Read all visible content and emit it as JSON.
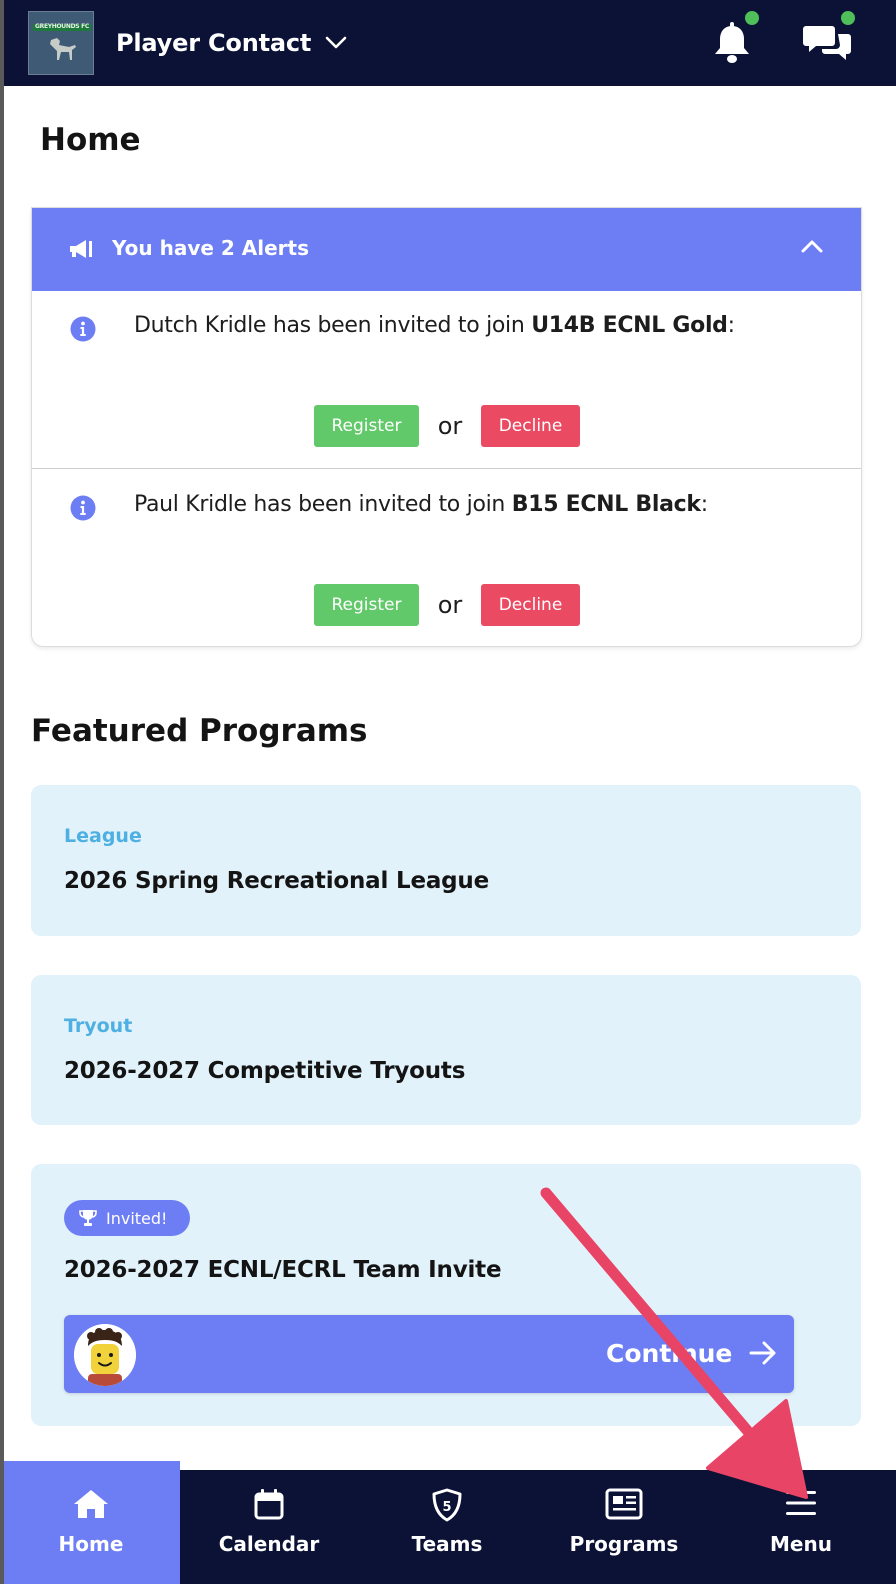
{
  "header": {
    "logo_text": "GREYHOUNDS FC",
    "account_name": "Player Contact"
  },
  "page": {
    "title": "Home"
  },
  "alerts": {
    "title": "You have 2 Alerts",
    "items": [
      {
        "text_prefix": "Dutch Kridle has been invited to join ",
        "team": "U14B ECNL Gold",
        "suffix": ":",
        "register_label": "Register",
        "or_label": "or",
        "decline_label": "Decline"
      },
      {
        "text_prefix": "Paul Kridle has been invited to join ",
        "team": "B15 ECNL Black",
        "suffix": ":",
        "register_label": "Register",
        "or_label": "or",
        "decline_label": "Decline"
      }
    ]
  },
  "featured": {
    "title": "Featured Programs",
    "programs": [
      {
        "type": "League",
        "name": "2026 Spring Recreational League"
      },
      {
        "type": "Tryout",
        "name": "2026-2027 Competitive Tryouts"
      },
      {
        "badge": "Invited!",
        "name": "2026-2027 ECNL/ECRL Team Invite",
        "button_label": "Continue"
      }
    ]
  },
  "nav": {
    "tabs": [
      {
        "label": "Home",
        "icon": "home-icon",
        "active": true
      },
      {
        "label": "Calendar",
        "icon": "calendar-icon"
      },
      {
        "label": "Teams",
        "icon": "shield-icon"
      },
      {
        "label": "Programs",
        "icon": "newspaper-icon"
      },
      {
        "label": "Menu",
        "icon": "hamburger-icon"
      }
    ]
  },
  "colors": {
    "navy": "#0b1236",
    "accent": "#6d7ef4",
    "register_green": "#62c96b",
    "decline_red": "#ea4a62",
    "card_bg": "#e2f2fb",
    "program_type": "#4eb0e2",
    "annotation_arrow": "#e84466"
  }
}
